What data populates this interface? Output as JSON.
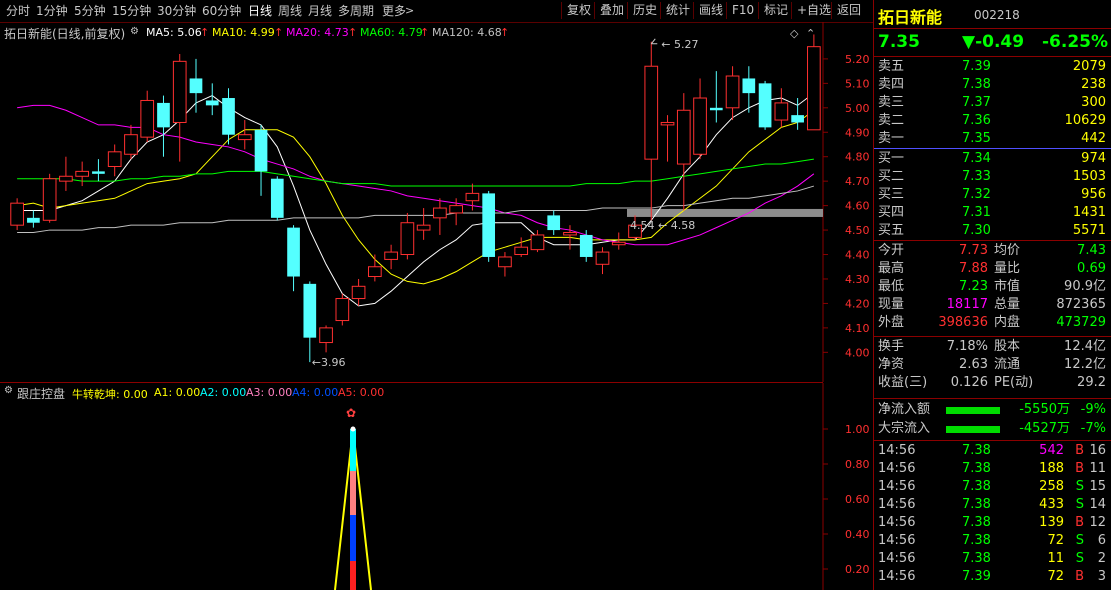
{
  "toolbar": {
    "periods": [
      "分时",
      "1分钟",
      "5分钟",
      "15分钟",
      "30分钟",
      "60分钟",
      "日线",
      "周线",
      "月线",
      "多周期",
      "更多"
    ],
    "active": "日线",
    "more_arrow": ">",
    "actions": [
      "复权",
      "叠加",
      "历史",
      "统计",
      "画线",
      "F10",
      "标记",
      "+自选",
      "返回"
    ]
  },
  "main_legend": {
    "title": "拓日新能(日线,前复权)",
    "ma": [
      {
        "label": "MA5: 5.06",
        "color": "#ffffff"
      },
      {
        "label": "MA10: 4.99",
        "color": "#ffff00"
      },
      {
        "label": "MA20: 4.73",
        "color": "#ff00ff"
      },
      {
        "label": "MA60: 4.79",
        "color": "#00ff00"
      },
      {
        "label": "MA120: 4.68",
        "color": "#c0c0c0"
      }
    ],
    "up_arrow": "↑"
  },
  "chart_data": [
    {
      "type": "candlestick",
      "title": "拓日新能(日线,前复权)",
      "y_ticks": [
        "5.20",
        "5.10",
        "5.00",
        "4.90",
        "4.80",
        "4.70",
        "4.60",
        "4.50",
        "4.40",
        "4.30",
        "4.20",
        "4.10",
        "4.00"
      ],
      "ylim": [
        3.94,
        5.31
      ],
      "candles": [
        {
          "o": 4.52,
          "c": 4.61,
          "h": 4.63,
          "l": 4.5
        },
        {
          "o": 4.55,
          "c": 4.53,
          "h": 4.58,
          "l": 4.51
        },
        {
          "o": 4.54,
          "c": 4.71,
          "h": 4.73,
          "l": 4.53
        },
        {
          "o": 4.7,
          "c": 4.72,
          "h": 4.8,
          "l": 4.66
        },
        {
          "o": 4.72,
          "c": 4.74,
          "h": 4.78,
          "l": 4.68
        },
        {
          "o": 4.74,
          "c": 4.73,
          "h": 4.79,
          "l": 4.7
        },
        {
          "o": 4.76,
          "c": 4.82,
          "h": 4.85,
          "l": 4.72
        },
        {
          "o": 4.81,
          "c": 4.89,
          "h": 4.93,
          "l": 4.79
        },
        {
          "o": 4.88,
          "c": 5.03,
          "h": 5.07,
          "l": 4.86
        },
        {
          "o": 5.02,
          "c": 4.92,
          "h": 5.05,
          "l": 4.8
        },
        {
          "o": 4.94,
          "c": 5.19,
          "h": 5.22,
          "l": 4.78
        },
        {
          "o": 5.12,
          "c": 5.06,
          "h": 5.2,
          "l": 4.98
        },
        {
          "o": 5.03,
          "c": 5.01,
          "h": 5.1,
          "l": 4.97
        },
        {
          "o": 5.04,
          "c": 4.89,
          "h": 5.08,
          "l": 4.85
        },
        {
          "o": 4.87,
          "c": 4.89,
          "h": 4.95,
          "l": 4.83
        },
        {
          "o": 4.91,
          "c": 4.74,
          "h": 4.93,
          "l": 4.64
        },
        {
          "o": 4.71,
          "c": 4.55,
          "h": 4.72,
          "l": 4.54
        },
        {
          "o": 4.51,
          "c": 4.31,
          "h": 4.52,
          "l": 4.25
        },
        {
          "o": 4.28,
          "c": 4.06,
          "h": 4.29,
          "l": 3.96
        },
        {
          "o": 4.04,
          "c": 4.1,
          "h": 4.11,
          "l": 4.0
        },
        {
          "o": 4.13,
          "c": 4.22,
          "h": 4.24,
          "l": 4.11
        },
        {
          "o": 4.22,
          "c": 4.27,
          "h": 4.3,
          "l": 4.19
        },
        {
          "o": 4.31,
          "c": 4.35,
          "h": 4.4,
          "l": 4.29
        },
        {
          "o": 4.38,
          "c": 4.41,
          "h": 4.44,
          "l": 4.34
        },
        {
          "o": 4.4,
          "c": 4.53,
          "h": 4.57,
          "l": 4.38
        },
        {
          "o": 4.5,
          "c": 4.52,
          "h": 4.59,
          "l": 4.46
        },
        {
          "o": 4.55,
          "c": 4.59,
          "h": 4.63,
          "l": 4.48
        },
        {
          "o": 4.57,
          "c": 4.6,
          "h": 4.63,
          "l": 4.52
        },
        {
          "o": 4.62,
          "c": 4.65,
          "h": 4.69,
          "l": 4.58
        },
        {
          "o": 4.65,
          "c": 4.39,
          "h": 4.66,
          "l": 4.37
        },
        {
          "o": 4.35,
          "c": 4.39,
          "h": 4.41,
          "l": 4.31
        },
        {
          "o": 4.4,
          "c": 4.43,
          "h": 4.47,
          "l": 4.39
        },
        {
          "o": 4.42,
          "c": 4.48,
          "h": 4.5,
          "l": 4.41
        },
        {
          "o": 4.56,
          "c": 4.5,
          "h": 4.58,
          "l": 4.48
        },
        {
          "o": 4.48,
          "c": 4.49,
          "h": 4.52,
          "l": 4.42
        },
        {
          "o": 4.48,
          "c": 4.39,
          "h": 4.5,
          "l": 4.37
        },
        {
          "o": 4.36,
          "c": 4.41,
          "h": 4.43,
          "l": 4.32
        },
        {
          "o": 4.44,
          "c": 4.45,
          "h": 4.49,
          "l": 4.42
        },
        {
          "o": 4.47,
          "c": 4.52,
          "h": 4.56,
          "l": 4.46
        },
        {
          "o": 4.79,
          "c": 5.17,
          "h": 5.27,
          "l": 4.54
        },
        {
          "o": 4.93,
          "c": 4.94,
          "h": 4.97,
          "l": 4.78
        },
        {
          "o": 4.77,
          "c": 4.99,
          "h": 5.06,
          "l": 4.58
        },
        {
          "o": 4.81,
          "c": 5.04,
          "h": 5.12,
          "l": 4.79
        },
        {
          "o": 5.0,
          "c": 4.99,
          "h": 5.15,
          "l": 4.94
        },
        {
          "o": 5.0,
          "c": 5.13,
          "h": 5.17,
          "l": 4.95
        },
        {
          "o": 5.12,
          "c": 5.06,
          "h": 5.17,
          "l": 4.98
        },
        {
          "o": 5.1,
          "c": 4.92,
          "h": 5.11,
          "l": 4.91
        },
        {
          "o": 4.95,
          "c": 5.02,
          "h": 5.08,
          "l": 4.92
        },
        {
          "o": 4.97,
          "c": 4.94,
          "h": 5.04,
          "l": 4.91
        },
        {
          "o": 4.91,
          "c": 5.25,
          "h": 5.3,
          "l": 4.91
        }
      ],
      "ma_series": [
        {
          "name": "MA5",
          "color": "#ffffff",
          "values": [
            4.58,
            4.58,
            4.58,
            4.6,
            4.62,
            4.66,
            4.7,
            4.79,
            4.86,
            4.89,
            4.95,
            5.02,
            5.05,
            5.0,
            4.96,
            4.93,
            4.84,
            4.68,
            4.5,
            4.36,
            4.24,
            4.19,
            4.2,
            4.25,
            4.31,
            4.37,
            4.42,
            4.46,
            4.52,
            4.53,
            4.53,
            4.53,
            4.47,
            4.44,
            4.44,
            4.44,
            4.45,
            4.46,
            4.46,
            4.54,
            4.63,
            4.73,
            4.8,
            4.89,
            4.96,
            5.0,
            5.03,
            5.04,
            5.01,
            5.06
          ]
        },
        {
          "name": "MA10",
          "color": "#ffff00",
          "values": [
            4.6,
            4.61,
            4.59,
            4.6,
            4.61,
            4.62,
            4.63,
            4.66,
            4.69,
            4.7,
            4.71,
            4.73,
            4.8,
            4.87,
            4.91,
            4.91,
            4.91,
            4.88,
            4.8,
            4.69,
            4.56,
            4.46,
            4.38,
            4.32,
            4.29,
            4.28,
            4.3,
            4.33,
            4.37,
            4.41,
            4.43,
            4.45,
            4.47,
            4.47,
            4.47,
            4.46,
            4.46,
            4.46,
            4.46,
            4.47,
            4.53,
            4.58,
            4.63,
            4.68,
            4.75,
            4.82,
            4.87,
            4.92,
            4.94,
            4.99
          ]
        },
        {
          "name": "MA20",
          "color": "#ff00ff",
          "values": [
            5.0,
            5.01,
            5.01,
            4.99,
            4.96,
            4.93,
            4.93,
            4.92,
            4.92,
            4.89,
            4.88,
            4.86,
            4.85,
            4.84,
            4.82,
            4.79,
            4.77,
            4.75,
            4.72,
            4.7,
            4.69,
            4.68,
            4.67,
            4.66,
            4.64,
            4.63,
            4.62,
            4.61,
            4.6,
            4.59,
            4.57,
            4.56,
            4.53,
            4.51,
            4.5,
            4.48,
            4.46,
            4.45,
            4.44,
            4.44,
            4.44,
            4.46,
            4.48,
            4.51,
            4.54,
            4.57,
            4.61,
            4.64,
            4.68,
            4.73
          ]
        },
        {
          "name": "MA60",
          "color": "#00ff00",
          "values": [
            4.71,
            4.71,
            4.71,
            4.71,
            4.7,
            4.7,
            4.7,
            4.71,
            4.71,
            4.72,
            4.72,
            4.73,
            4.73,
            4.74,
            4.74,
            4.74,
            4.73,
            4.72,
            4.71,
            4.7,
            4.69,
            4.69,
            4.69,
            4.68,
            4.68,
            4.68,
            4.68,
            4.68,
            4.68,
            4.68,
            4.68,
            4.68,
            4.68,
            4.68,
            4.68,
            4.69,
            4.69,
            4.69,
            4.7,
            4.7,
            4.71,
            4.72,
            4.73,
            4.74,
            4.75,
            4.76,
            4.77,
            4.77,
            4.78,
            4.79
          ]
        },
        {
          "name": "MA120",
          "color": "#c0c0c0",
          "values": [
            4.49,
            4.49,
            4.5,
            4.5,
            4.5,
            4.51,
            4.51,
            4.52,
            4.52,
            4.52,
            4.53,
            4.53,
            4.53,
            4.54,
            4.54,
            4.54,
            4.54,
            4.55,
            4.55,
            4.55,
            4.55,
            4.55,
            4.56,
            4.56,
            4.56,
            4.56,
            4.56,
            4.57,
            4.57,
            4.57,
            4.57,
            4.58,
            4.58,
            4.58,
            4.58,
            4.58,
            4.59,
            4.59,
            4.59,
            4.59,
            4.6,
            4.6,
            4.61,
            4.62,
            4.63,
            4.63,
            4.64,
            4.65,
            4.66,
            4.68
          ]
        }
      ],
      "annotations": {
        "high": "5.27",
        "low": "3.96",
        "mid1": "4.54",
        "mid2": "4.58"
      },
      "gray_bar_level": 4.57
    },
    {
      "type": "bar",
      "title": "跟庄控盘",
      "y_ticks": [
        "1.00",
        "0.80",
        "0.60",
        "0.40",
        "0.20"
      ],
      "ylim": [
        0,
        1.15
      ],
      "spike_index": 19,
      "spike_value": 1.0
    }
  ],
  "sub_legend": {
    "title": "跟庄控盘",
    "items": [
      {
        "label": "牛转乾坤: 0.00",
        "color": "#ffff00"
      },
      {
        "label": "A1: 0.00",
        "color": "#ffff00"
      },
      {
        "label": "A2: 0.00",
        "color": "#00ffff"
      },
      {
        "label": "A3: 0.00",
        "color": "#ff80c0"
      },
      {
        "label": "A4: 0.00",
        "color": "#0050ff"
      },
      {
        "label": "A5: 0.00",
        "color": "#ff3030"
      }
    ]
  },
  "quote": {
    "name": "拓日新能",
    "code": "002218",
    "price": "7.35",
    "change": "▼-0.49",
    "pct": "-6.25%",
    "asks": [
      {
        "label": "卖五",
        "price": "7.39",
        "vol": "2079"
      },
      {
        "label": "卖四",
        "price": "7.38",
        "vol": "238"
      },
      {
        "label": "卖三",
        "price": "7.37",
        "vol": "300"
      },
      {
        "label": "卖二",
        "price": "7.36",
        "vol": "10629"
      },
      {
        "label": "卖一",
        "price": "7.35",
        "vol": "442"
      }
    ],
    "bids": [
      {
        "label": "买一",
        "price": "7.34",
        "vol": "974"
      },
      {
        "label": "买二",
        "price": "7.33",
        "vol": "1503"
      },
      {
        "label": "买三",
        "price": "7.32",
        "vol": "956"
      },
      {
        "label": "买四",
        "price": "7.31",
        "vol": "1431"
      },
      {
        "label": "买五",
        "price": "7.30",
        "vol": "5571"
      }
    ],
    "stats": [
      {
        "l1": "今开",
        "v1": "7.73",
        "c1": "#ff3030",
        "l2": "均价",
        "v2": "7.43",
        "c2": "#00ff00"
      },
      {
        "l1": "最高",
        "v1": "7.88",
        "c1": "#ff3030",
        "l2": "量比",
        "v2": "0.69",
        "c2": "#00ff00"
      },
      {
        "l1": "最低",
        "v1": "7.23",
        "c1": "#00ff00",
        "l2": "市值",
        "v2": "90.9亿",
        "c2": "#c8c8c8"
      },
      {
        "l1": "现量",
        "v1": "18117",
        "c1": "#ff00ff",
        "l2": "总量",
        "v2": "872365",
        "c2": "#c8c8c8"
      },
      {
        "l1": "外盘",
        "v1": "398636",
        "c1": "#ff3030",
        "l2": "内盘",
        "v2": "473729",
        "c2": "#00ff00"
      }
    ],
    "stats2": [
      {
        "l1": "换手",
        "v1": "7.18%",
        "l2": "股本",
        "v2": "12.4亿"
      },
      {
        "l1": "净资",
        "v1": "2.63",
        "l2": "流通",
        "v2": "12.2亿"
      },
      {
        "l1": "收益(三)",
        "v1": "0.126",
        "l2": "PE(动)",
        "v2": "29.2"
      }
    ],
    "flows": [
      {
        "label": "净流入额",
        "value": "-5550万",
        "pct": "-9%"
      },
      {
        "label": "大宗流入",
        "value": "-4527万",
        "pct": "-7%"
      }
    ],
    "ticks": [
      {
        "t": "14:56",
        "p": "7.38",
        "v": "542",
        "vc": "#ff00ff",
        "d": "B",
        "n": "16"
      },
      {
        "t": "14:56",
        "p": "7.38",
        "v": "188",
        "vc": "#ffff00",
        "d": "B",
        "n": "11"
      },
      {
        "t": "14:56",
        "p": "7.38",
        "v": "258",
        "vc": "#ffff00",
        "d": "S",
        "n": "15"
      },
      {
        "t": "14:56",
        "p": "7.38",
        "v": "433",
        "vc": "#ffff00",
        "d": "S",
        "n": "14"
      },
      {
        "t": "14:56",
        "p": "7.38",
        "v": "139",
        "vc": "#ffff00",
        "d": "B",
        "n": "12"
      },
      {
        "t": "14:56",
        "p": "7.38",
        "v": "72",
        "vc": "#ffff00",
        "d": "S",
        "n": "6"
      },
      {
        "t": "14:56",
        "p": "7.38",
        "v": "11",
        "vc": "#ffff00",
        "d": "S",
        "n": "2"
      },
      {
        "t": "14:56",
        "p": "7.39",
        "v": "72",
        "vc": "#ffff00",
        "d": "B",
        "n": "3"
      }
    ]
  }
}
